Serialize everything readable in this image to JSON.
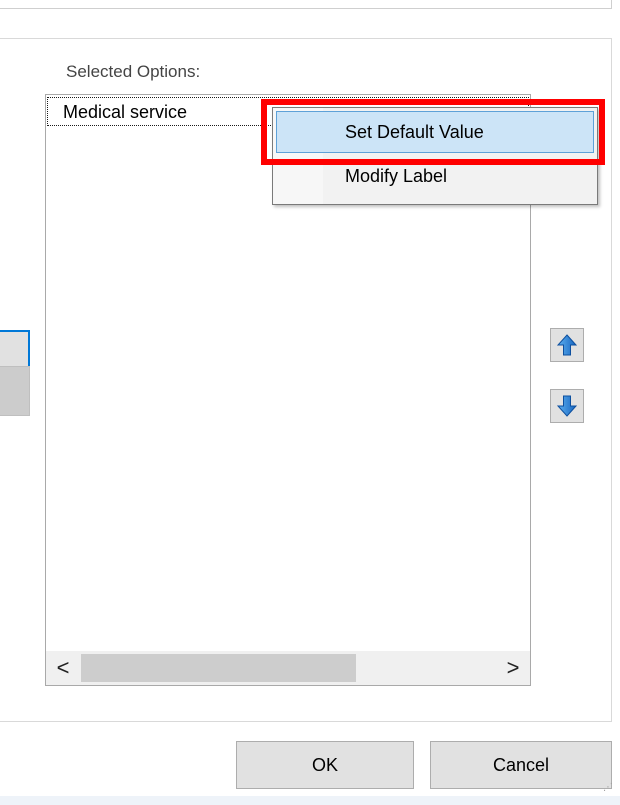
{
  "dialog": {
    "selected_options_label": "Selected Options:",
    "selected_options": [
      "Medical service"
    ]
  },
  "context_menu": {
    "items": [
      {
        "label": "Set Default Value",
        "highlighted": true
      },
      {
        "label": "Modify Label",
        "highlighted": false
      }
    ],
    "annotation_color": "#ff0000",
    "hover_color": "#cce4f7"
  },
  "scrollbar": {
    "left_arrow": "<",
    "right_arrow": ">"
  },
  "move_buttons": {
    "up_icon": "arrow-up-icon",
    "down_icon": "arrow-down-icon",
    "color": "#1e7bd8"
  },
  "footer": {
    "ok_label": "OK",
    "cancel_label": "Cancel"
  }
}
